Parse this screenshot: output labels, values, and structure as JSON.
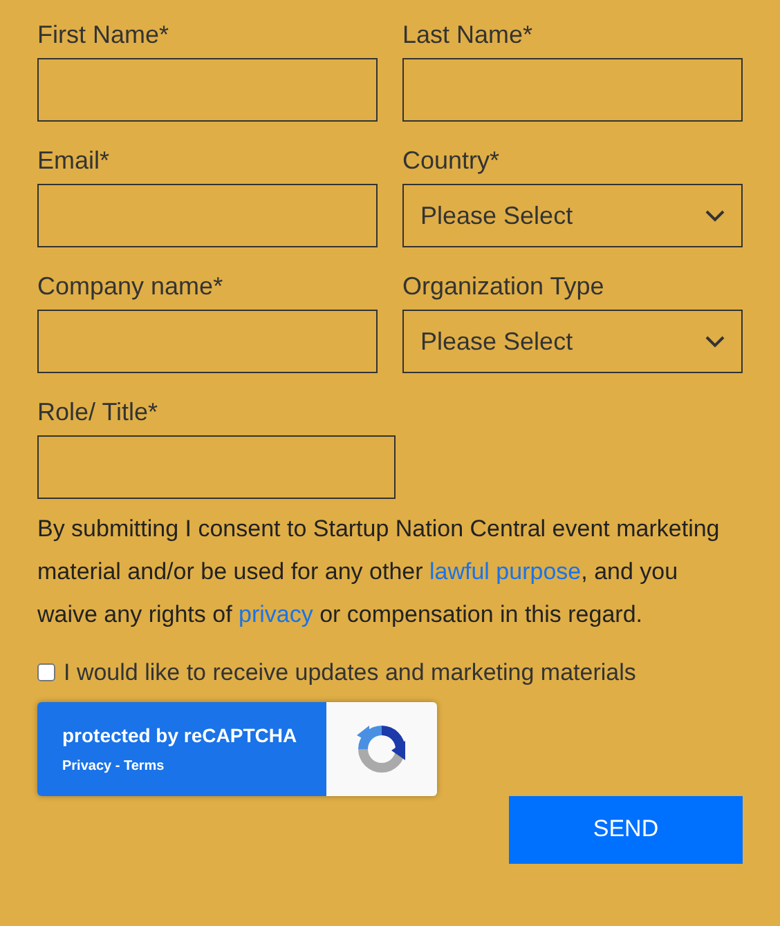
{
  "fields": [
    {
      "label": "First Name*",
      "kind": "text"
    },
    {
      "label": "Last Name*",
      "kind": "text"
    },
    {
      "label": "Email*",
      "kind": "text"
    },
    {
      "label": "Country*",
      "kind": "select",
      "value": "Please Select"
    },
    {
      "label": "Company name*",
      "kind": "text"
    },
    {
      "label": "Organization Type",
      "kind": "select",
      "value": "Please Select"
    },
    {
      "label": "Role/ Title*",
      "kind": "text"
    }
  ],
  "consent": [
    {
      "kind": "text",
      "text": "By submitting I consent to Startup Nation Central event marketing material and/or be used for any other "
    },
    {
      "kind": "link",
      "text": "lawful purpose"
    },
    {
      "kind": "text",
      "text": ", and you waive any rights of "
    },
    {
      "kind": "link",
      "text": "privacy"
    },
    {
      "kind": "text",
      "text": " or compensation in this regard."
    }
  ],
  "updates_checkbox": {
    "label": "I would like to receive updates and marketing materials",
    "checked": false
  },
  "recaptcha": {
    "title": "protected by reCAPTCHA",
    "links": "Privacy - Terms"
  },
  "submit": "SEND"
}
